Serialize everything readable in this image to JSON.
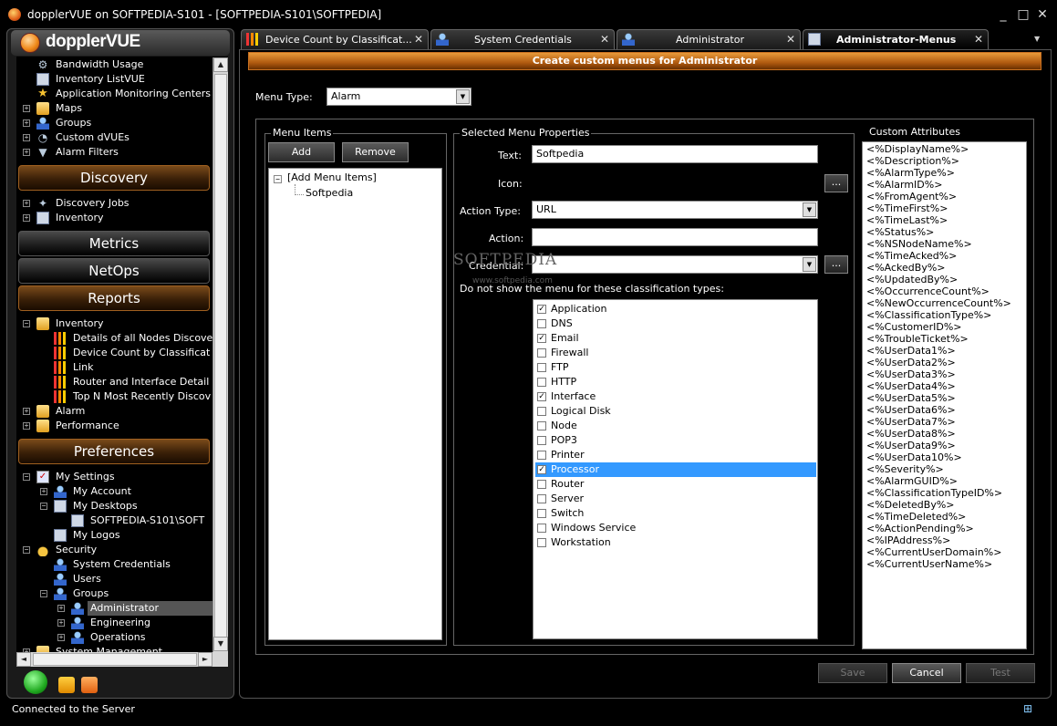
{
  "window": {
    "title": "dopplerVUE on SOFTPEDIA-S101 - [SOFTPEDIA-S101\\SOFTPEDIA]",
    "minimize": "_",
    "maximize": "□",
    "close": "✕"
  },
  "logo": "dopplerVUE",
  "tree_top": [
    {
      "label": "Bandwidth Usage",
      "icon": "gear-icon"
    },
    {
      "label": "Inventory ListVUE",
      "icon": "doc-icon"
    },
    {
      "label": "Application Monitoring Centers",
      "icon": "star-icon"
    },
    {
      "label": "Maps",
      "icon": "map-icon"
    },
    {
      "label": "Groups",
      "icon": "groups-icon"
    },
    {
      "label": "Custom dVUEs",
      "icon": "gauge-icon"
    },
    {
      "label": "Alarm Filters",
      "icon": "filter-icon"
    }
  ],
  "sections": {
    "discovery": "Discovery",
    "metrics": "Metrics",
    "netops": "NetOps",
    "reports": "Reports",
    "preferences": "Preferences"
  },
  "tree_discovery": [
    {
      "label": "Discovery Jobs"
    },
    {
      "label": "Inventory"
    }
  ],
  "tree_reports": [
    {
      "label": "Inventory"
    },
    {
      "label": "Details of all Nodes Discove"
    },
    {
      "label": "Device Count by Classificat"
    },
    {
      "label": "Link"
    },
    {
      "label": "Router and Interface Detail"
    },
    {
      "label": "Top N Most Recently Discov"
    },
    {
      "label": "Alarm"
    },
    {
      "label": "Performance"
    }
  ],
  "tree_prefs": [
    {
      "label": "My Settings"
    },
    {
      "label": "My Account"
    },
    {
      "label": "My Desktops"
    },
    {
      "label": "SOFTPEDIA-S101\\SOFT"
    },
    {
      "label": "My Logos"
    },
    {
      "label": "Security"
    },
    {
      "label": "System Credentials"
    },
    {
      "label": "Users"
    },
    {
      "label": "Groups"
    },
    {
      "label": "Administrator"
    },
    {
      "label": "Engineering"
    },
    {
      "label": "Operations"
    },
    {
      "label": "System Management"
    }
  ],
  "scroll": {
    "up": "▲",
    "down": "▼",
    "left": "◄",
    "right": "►"
  },
  "status": "Connected to the Server",
  "tabs": [
    {
      "label": "Device Count by Classificat...",
      "close": "✕"
    },
    {
      "label": "System Credentials",
      "close": "✕"
    },
    {
      "label": "Administrator",
      "close": "✕"
    },
    {
      "label": "Administrator-Menus",
      "close": "✕"
    }
  ],
  "tab_dropdown": "▼",
  "main": {
    "header": "Create custom menus for Administrator",
    "menu_type_label": "Menu Type:",
    "menu_type_value": "Alarm",
    "menu_items_legend": "Menu Items",
    "add_button": "Add",
    "remove_button": "Remove",
    "tree_root": "[Add Menu Items]",
    "tree_child": "Softpedia",
    "props_legend": "Selected Menu Properties",
    "text_label": "Text:",
    "text_value": "Softpedia",
    "icon_label": "Icon:",
    "action_type_label": "Action Type:",
    "action_type_value": "URL",
    "action_label": "Action:",
    "action_value": "",
    "credential_label": "Credential:",
    "credential_value": "",
    "ellipsis": "...",
    "arrow": "▼",
    "exclude_label": "Do not show the menu for these classification types:",
    "classifications": [
      {
        "label": "Application",
        "checked": true
      },
      {
        "label": "DNS",
        "checked": false
      },
      {
        "label": "Email",
        "checked": true
      },
      {
        "label": "Firewall",
        "checked": false
      },
      {
        "label": "FTP",
        "checked": false
      },
      {
        "label": "HTTP",
        "checked": false
      },
      {
        "label": "Interface",
        "checked": true
      },
      {
        "label": "Logical Disk",
        "checked": false
      },
      {
        "label": "Node",
        "checked": false
      },
      {
        "label": "POP3",
        "checked": false
      },
      {
        "label": "Printer",
        "checked": false
      },
      {
        "label": "Processor",
        "checked": true
      },
      {
        "label": "Router",
        "checked": false
      },
      {
        "label": "Server",
        "checked": false
      },
      {
        "label": "Switch",
        "checked": false
      },
      {
        "label": "Windows Service",
        "checked": false
      },
      {
        "label": "Workstation",
        "checked": false
      }
    ],
    "highlighted_classification": "Processor",
    "attrs_legend": "Custom Attributes",
    "attributes": [
      "<%DisplayName%>",
      "<%Description%>",
      "<%AlarmType%>",
      "<%AlarmID%>",
      "<%FromAgent%>",
      "<%TimeFirst%>",
      "<%TimeLast%>",
      "<%Status%>",
      "<%NSNodeName%>",
      "<%TimeAcked%>",
      "<%AckedBy%>",
      "<%UpdatedBy%>",
      "<%OccurrenceCount%>",
      "<%NewOccurrenceCount%>",
      "<%ClassificationType%>",
      "<%CustomerID%>",
      "<%TroubleTicket%>",
      "<%UserData1%>",
      "<%UserData2%>",
      "<%UserData3%>",
      "<%UserData4%>",
      "<%UserData5%>",
      "<%UserData6%>",
      "<%UserData7%>",
      "<%UserData8%>",
      "<%UserData9%>",
      "<%UserData10%>",
      "<%Severity%>",
      "<%AlarmGUID%>",
      "<%ClassificationTypeID%>",
      "<%DeletedBy%>",
      "<%TimeDeleted%>",
      "<%ActionPending%>",
      "<%IPAddress%>",
      "<%CurrentUserDomain%>",
      "<%CurrentUserName%>"
    ],
    "save_button": "Save",
    "cancel_button": "Cancel",
    "test_button": "Test"
  },
  "watermark": "SOFTPEDIA",
  "watermark_sub": "www.softpedia.com",
  "colors": {
    "accent": "#c87020",
    "selection": "#3399ff",
    "background": "#000000"
  }
}
